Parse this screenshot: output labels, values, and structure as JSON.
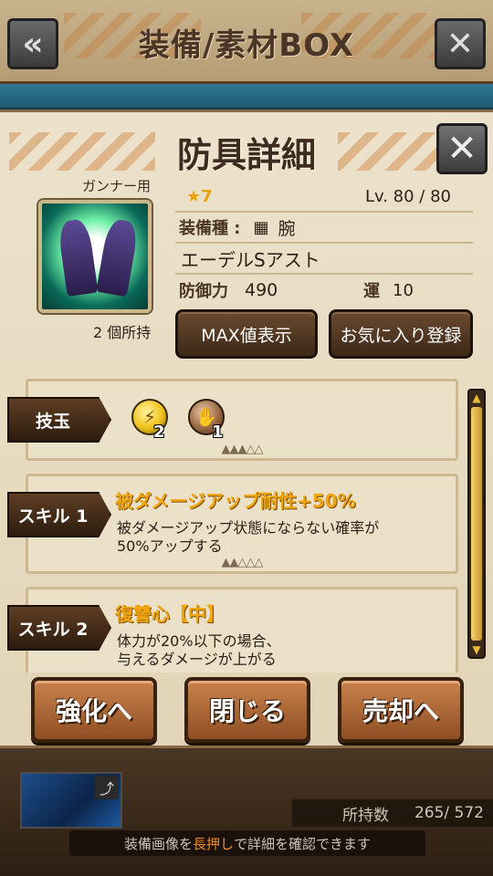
{
  "header": {
    "title": "装備/素材BOX",
    "back_icon": "arrow-left-icon",
    "close_icon": "close-icon"
  },
  "dialog": {
    "title": "防具詳細",
    "close_icon": "close-icon",
    "usage_label": "ガンナー用",
    "owned_count": "2 個所持",
    "rarity": "★7",
    "level": "Lv. 80 / 80",
    "type_label": "装備種 :",
    "type_icon": "gauntlet-icon",
    "type_value": "腕",
    "item_name": "エーデルSアスト",
    "defense_label": "防御力",
    "defense_value": "490",
    "luck_label": "運",
    "luck_value": "10",
    "max_button": "MAX値表示",
    "favorite_button": "お気に入り登録"
  },
  "skill_orbs": {
    "label": "技玉",
    "orbs": [
      {
        "icon": "lightning-orb-icon",
        "count": "2",
        "color": "#f0c21a"
      },
      {
        "icon": "claw-orb-icon",
        "count": "1",
        "color": "#9a6a44"
      }
    ]
  },
  "skills": [
    {
      "label": "スキル 1",
      "title": "被ダメージアップ耐性+50%",
      "desc_line1": "被ダメージアップ状態にならない確率が",
      "desc_line2": "50%アップする"
    },
    {
      "label": "スキル 2",
      "title": "復讐心【中】",
      "desc_line1": "体力が20%以下の場合、",
      "desc_line2": "与えるダメージが上がる"
    }
  ],
  "buttons": {
    "upgrade": "強化へ",
    "close": "閉じる",
    "sell": "売却へ"
  },
  "footer": {
    "owned_label": "所持数",
    "owned_value": "265/ 572",
    "hint_prefix": "装備画像を",
    "hint_highlight": "長押し",
    "hint_suffix": "で詳細を確認できます"
  }
}
